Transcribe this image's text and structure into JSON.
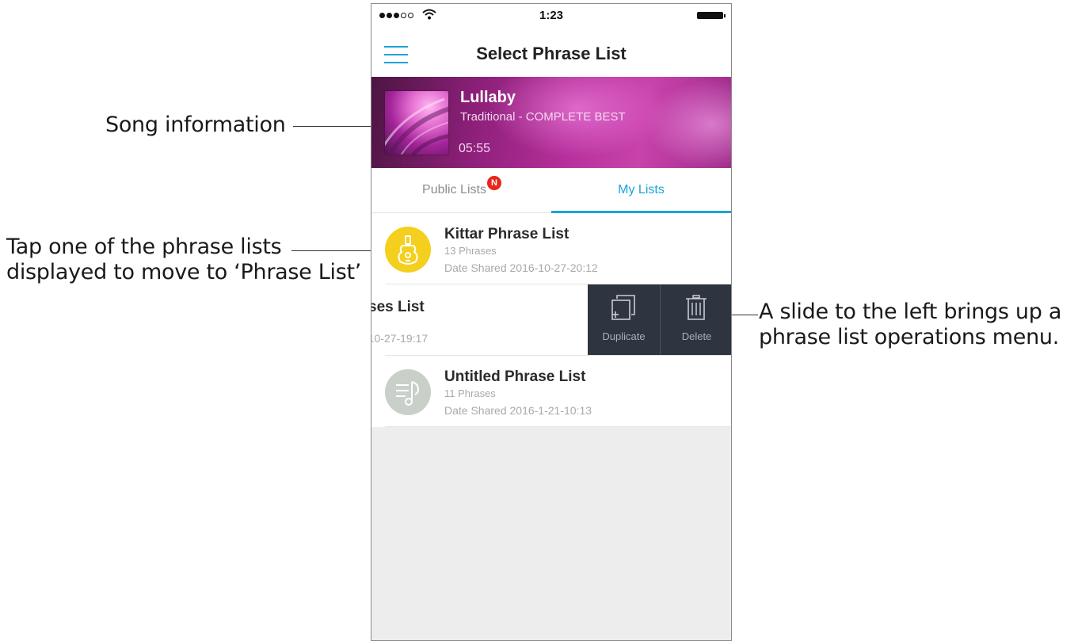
{
  "annotations": {
    "song": "Song information",
    "tap": "Tap one of the phrase lists displayed to move to  ‘Phrase List’",
    "slide": "A slide to the left brings up a phrase list operations menu."
  },
  "status_bar": {
    "time": "1:23"
  },
  "nav": {
    "title": "Select Phrase List"
  },
  "song": {
    "title": "Lullaby",
    "artist": "Traditional - COMPLETE BEST",
    "duration": "05:55"
  },
  "tabs": [
    {
      "label": "Public Lists",
      "badge": "N"
    },
    {
      "label": "My Lists"
    }
  ],
  "lists": [
    {
      "title": "Kittar Phrase List",
      "count": "13 Phrases",
      "date": "Date Shared 2016-10-27-20:12",
      "icon": "guitar-icon"
    },
    {
      "title": "ses List",
      "date": "-10-27-19:17"
    },
    {
      "title": "Untitled Phrase List",
      "count": "11 Phrases",
      "date": "Date Shared 2016-1-21-10:13",
      "icon": "music-note-list-icon"
    }
  ],
  "actions": {
    "duplicate": "Duplicate",
    "delete": "Delete"
  },
  "colors": {
    "accent": "#1aa3d9",
    "badge": "#e8261a",
    "action_bg": "#2e3440",
    "guitar_avatar": "#f5cf1d"
  }
}
